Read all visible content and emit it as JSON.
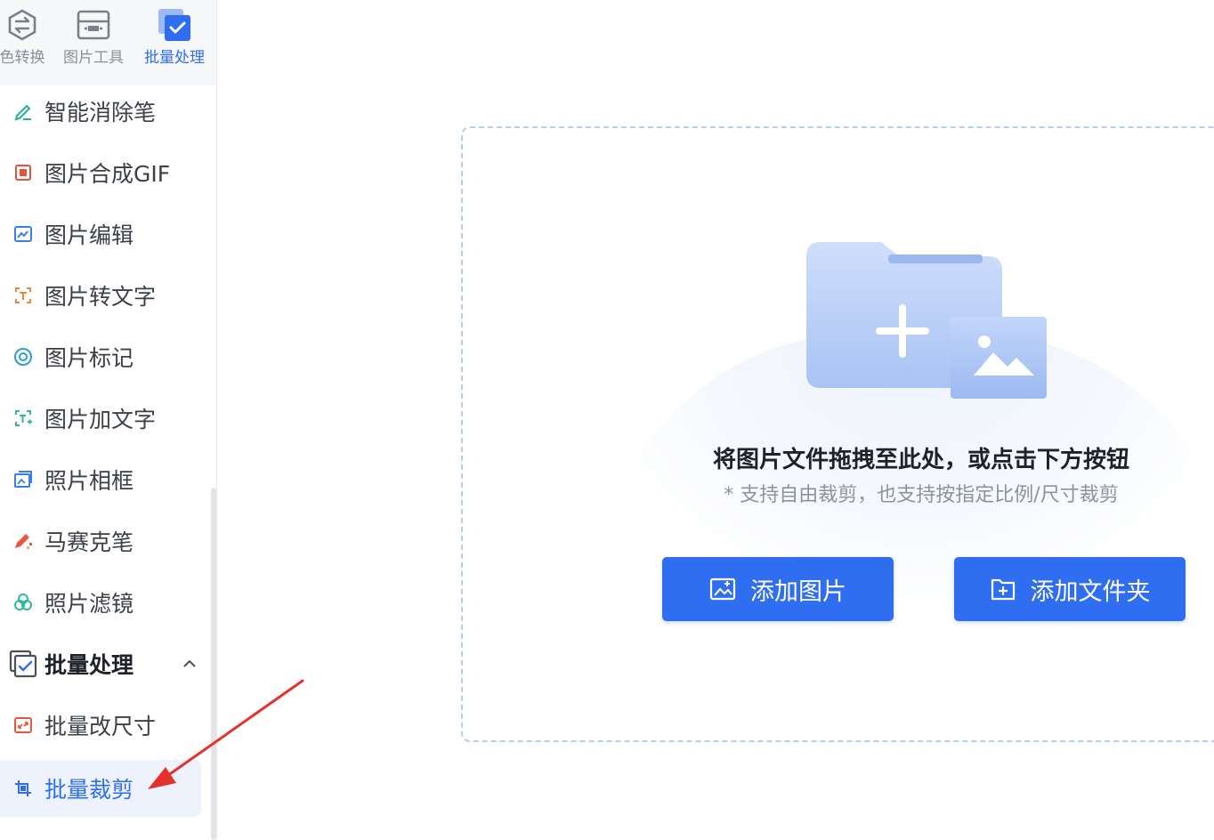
{
  "top_nav": {
    "items": [
      {
        "label": "色转换",
        "icon": "color-convert-icon"
      },
      {
        "label": "图片工具",
        "icon": "image-tools-icon"
      },
      {
        "label": "批量处理",
        "icon": "batch-process-icon",
        "active": true
      }
    ]
  },
  "sidebar": {
    "items": [
      {
        "label": "智能消除笔",
        "icon": "pen-icon"
      },
      {
        "label": "图片合成GIF",
        "icon": "gif-icon"
      },
      {
        "label": "图片编辑",
        "icon": "image-edit-icon"
      },
      {
        "label": "图片转文字",
        "icon": "ocr-icon"
      },
      {
        "label": "图片标记",
        "icon": "target-icon"
      },
      {
        "label": "图片加文字",
        "icon": "add-text-icon"
      },
      {
        "label": "照片相框",
        "icon": "frame-icon"
      },
      {
        "label": "马赛克笔",
        "icon": "mosaic-pen-icon"
      },
      {
        "label": "照片滤镜",
        "icon": "filter-icon"
      }
    ],
    "group": {
      "label": "批量处理",
      "icon": "batch-process-icon",
      "expanded": true
    },
    "group_items": [
      {
        "label": "批量改尺寸",
        "icon": "resize-icon"
      },
      {
        "label": "批量裁剪",
        "icon": "crop-icon",
        "active": true
      }
    ]
  },
  "main": {
    "headline": "将图片文件拖拽至此处，或点击下方按钮",
    "subline": "* 支持自由裁剪，也支持按指定比例/尺寸裁剪",
    "add_image_button": "添加图片",
    "add_folder_button": "添加文件夹"
  },
  "colors": {
    "accent": "#2f6ef0",
    "annotation_arrow": "#e5312b"
  }
}
